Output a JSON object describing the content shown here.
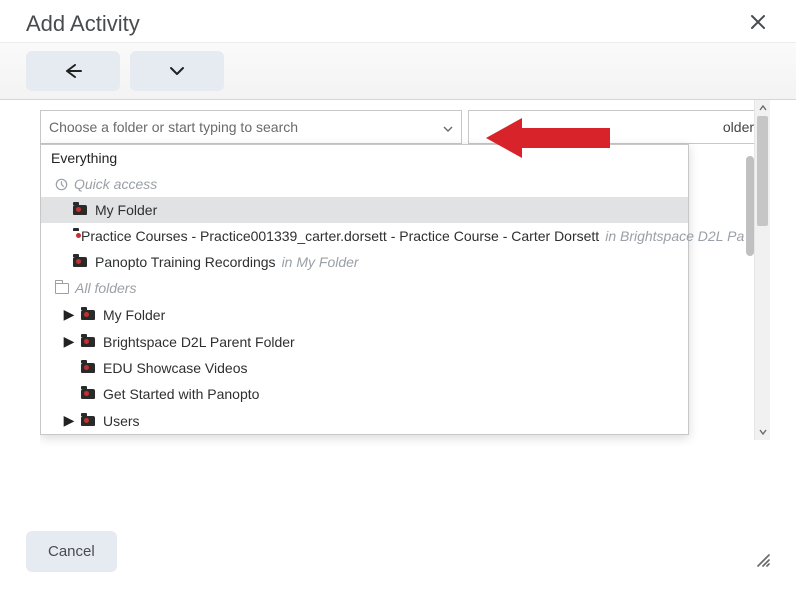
{
  "modal": {
    "title": "Add Activity",
    "close_label": "Close"
  },
  "toolbar": {
    "back_label": "Back",
    "chevron_label": "More"
  },
  "combo": {
    "placeholder": "Choose a folder or start typing to search"
  },
  "right_box": {
    "visible_tail": "older\""
  },
  "dropdown": {
    "everything_label": "Everything",
    "quick_access_label": "Quick access",
    "all_folders_label": "All folders",
    "quick_items": [
      {
        "label": "My Folder",
        "highlight": true
      },
      {
        "label": "Practice Courses - Practice001339_carter.dorsett - Practice Course - Carter Dorsett",
        "sub": "in Brightspace D2L Pa"
      },
      {
        "label": "Panopto Training Recordings",
        "sub": "in My Folder"
      }
    ],
    "tree_items": [
      {
        "label": "My Folder",
        "expandable": true
      },
      {
        "label": "Brightspace D2L Parent Folder",
        "expandable": true
      },
      {
        "label": "EDU Showcase Videos",
        "expandable": false
      },
      {
        "label": "Get Started with Panopto",
        "expandable": false
      },
      {
        "label": "Users",
        "expandable": true
      }
    ]
  },
  "footer": {
    "cancel_label": "Cancel"
  }
}
